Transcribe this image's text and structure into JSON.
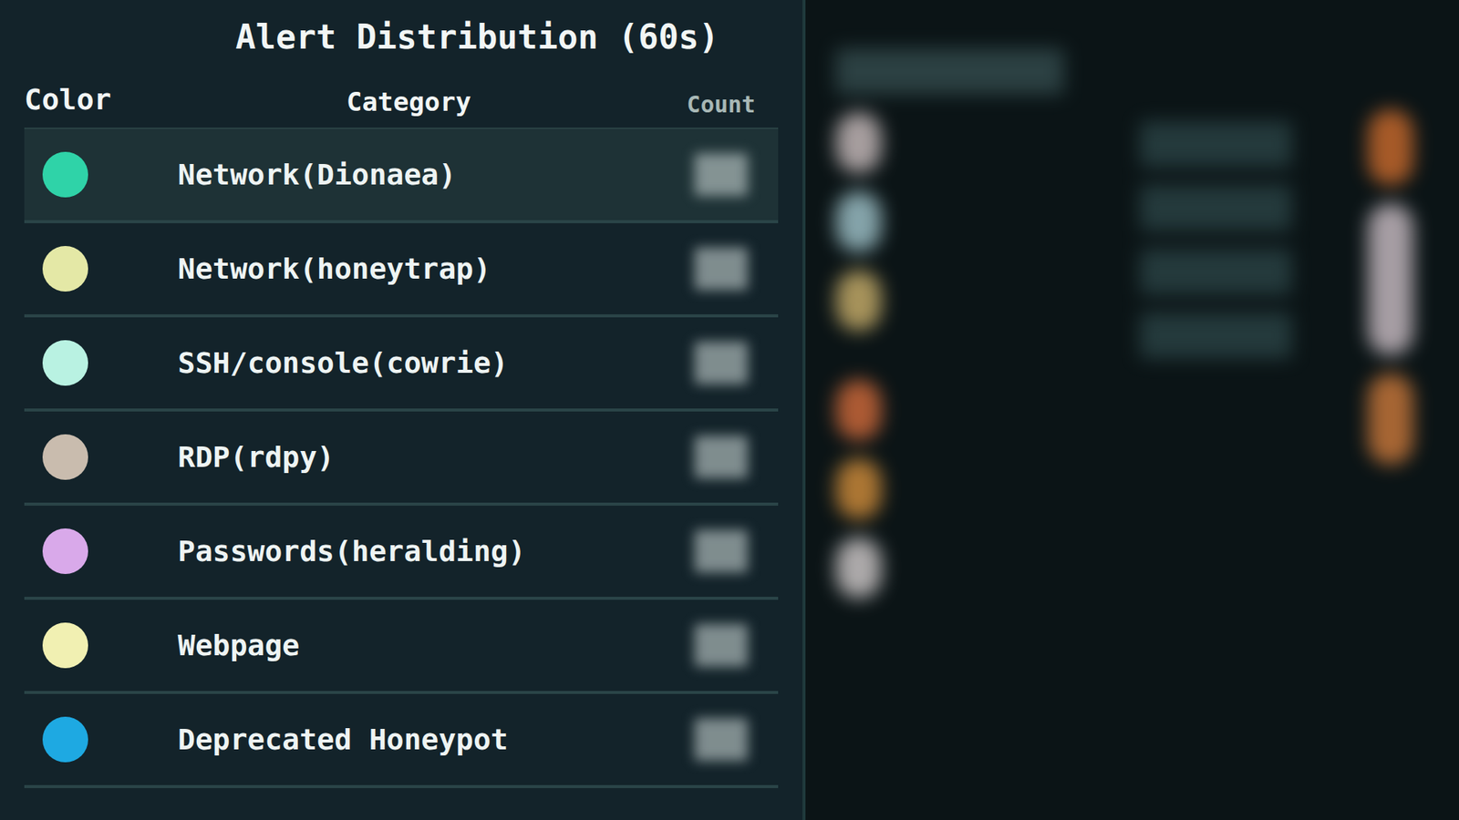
{
  "panel": {
    "title": "Alert Distribution (60s)",
    "columns": [
      "Color",
      "Category",
      "Count"
    ],
    "rows": [
      {
        "category": "Network(Dionaea)",
        "color": "#2fd3a8",
        "selected": true
      },
      {
        "category": "Network(honeytrap)",
        "color": "#e4e8a6",
        "selected": false
      },
      {
        "category": "SSH/console(cowrie)",
        "color": "#b9f2e2",
        "selected": false
      },
      {
        "category": "RDP(rdpy)",
        "color": "#c9bcae",
        "selected": false
      },
      {
        "category": "Passwords(heralding)",
        "color": "#d9a9ea",
        "selected": false
      },
      {
        "category": "Webpage",
        "color": "#f1f0b2",
        "selected": false
      },
      {
        "category": "Deprecated Honeypot",
        "color": "#1ea9e2",
        "selected": false
      }
    ]
  }
}
